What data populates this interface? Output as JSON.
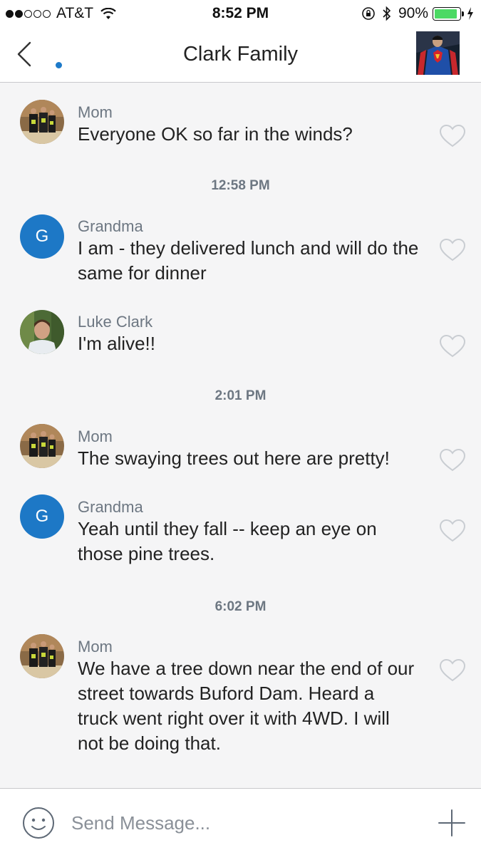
{
  "status_bar": {
    "carrier": "AT&T",
    "time": "8:52 PM",
    "battery_percent": "90%",
    "battery_level": 0.9,
    "signal_bars": 2,
    "icons": [
      "wifi-icon",
      "orientation-lock-icon",
      "bluetooth-icon",
      "battery-icon",
      "charging-icon"
    ]
  },
  "header": {
    "title": "Clark Family",
    "back_icon": "chevron-left-icon",
    "unread_indicator": true
  },
  "messages": [
    {
      "sender": "Mom",
      "avatar": "photo",
      "text": "Everyone OK so far in the winds?"
    },
    {
      "timestamp": "12:58 PM"
    },
    {
      "sender": "Grandma",
      "avatar": "G",
      "text": "I am - they delivered lunch and will do the same for dinner"
    },
    {
      "sender": "Luke Clark",
      "avatar": "photo",
      "text": "I'm alive!!"
    },
    {
      "timestamp": "2:01 PM"
    },
    {
      "sender": "Mom",
      "avatar": "photo",
      "text": "The swaying trees out here are pretty!"
    },
    {
      "sender": "Grandma",
      "avatar": "G",
      "text": "Yeah until they fall -- keep an eye on those pine trees."
    },
    {
      "timestamp": "6:02 PM"
    },
    {
      "sender": "Mom",
      "avatar": "photo",
      "text": "We have a tree down near the end of our street towards Buford Dam. Heard a truck went right over it with 4WD. I will not be doing that."
    }
  ],
  "composer": {
    "placeholder": "Send Message...",
    "emoji_icon": "smiley-icon",
    "add_icon": "plus-icon"
  },
  "colors": {
    "accent": "#1d78c6",
    "background": "#f5f5f6",
    "meta_text": "#6d7782"
  }
}
